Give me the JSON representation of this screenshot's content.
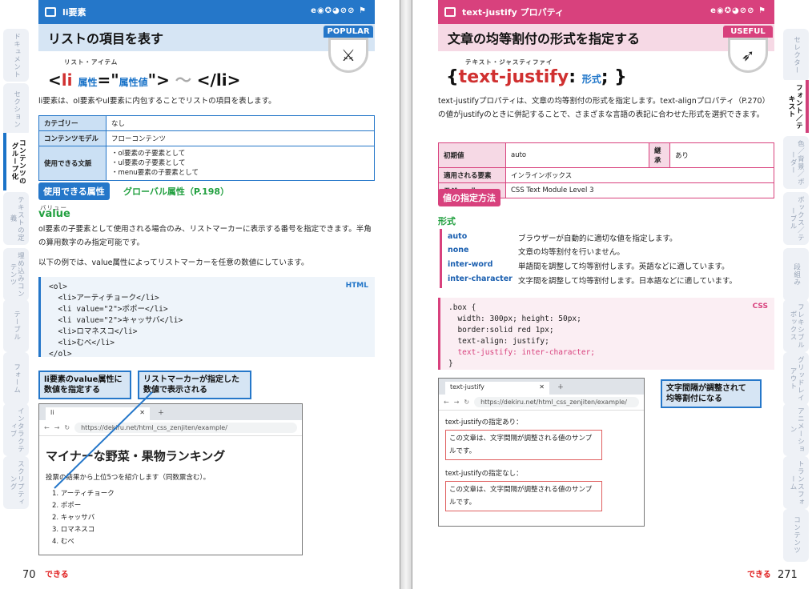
{
  "left": {
    "tabs": [
      "ドキュメント",
      "セクション",
      "コンテンツのグループ化",
      "テキストの定義",
      "埋め込みコンテンツ",
      "テーブル",
      "フォーム",
      "インタラクティブ",
      "スクリプティング"
    ],
    "header": {
      "label": "li要素",
      "browsers": "e◉✪◕⊘⊘ ⚑"
    },
    "title": "リストの項目を表す",
    "badge": "POPULAR",
    "syntax_ruby": "リスト・アイテム",
    "syntax": {
      "open_lt": "<",
      "tag": "li",
      "attr": "属性",
      "eq": "=\"",
      "val": "属性値",
      "close": "\">",
      "tilde": "〜",
      "end": "</li>"
    },
    "desc": "li要素は、ol要素やul要素に内包することでリストの項目を表します。",
    "table": [
      {
        "k": "カテゴリー",
        "v": "なし"
      },
      {
        "k": "コンテンツモデル",
        "v": "フローコンテンツ"
      },
      {
        "k": "使用できる文脈",
        "v": "・ol要素の子要素として\n・ul要素の子要素として\n・menu要素の子要素として"
      }
    ],
    "attr_section": "使用できる属性",
    "global_attr": "グローバル属性（P.198）",
    "value_ruby": "バリュー",
    "value_name": "value",
    "value_desc": "ol要素の子要素として使用される場合のみ、リストマーカーに表示する番号を指定できます。半角の算用数字のみ指定可能です。",
    "example_desc": "以下の例では、value属性によってリストマーカーを任意の数値にしています。",
    "code_lang": "HTML",
    "code_lines": [
      "<ol>",
      "  <li>アーティチョーク</li>",
      "  <li value=\"2\">ポポー</li>",
      "  <li value=\"2\">キャッサバ</li>",
      "  <li>ロマネスコ</li>",
      "  <li>むべ</li>",
      "</ol>"
    ],
    "callout1": "li要素のvalue属性に\n数値を指定する",
    "callout2": "リストマーカーが指定した\n数値で表示される",
    "browser": {
      "tab": "li",
      "url": "https://dekiru.net/html_css_zenjiten/example/",
      "h1": "マイナーな野菜・果物ランキング",
      "p": "投票の結果から上位5つを紹介します（同数票含む）。",
      "items": [
        "1. アーティチョーク",
        "2. ポポー",
        "2. キャッサバ",
        "3. ロマネスコ",
        "4. むべ"
      ]
    },
    "page_num": "70",
    "logo": "できる"
  },
  "right": {
    "tabs": [
      "セレクター",
      "フォント／テキスト",
      "色／背景／ボーダー",
      "ボックス／テーブル",
      "段組み",
      "フレキシブルボックス",
      "グリッドレイアウト",
      "アニメーション",
      "トランスフォーム",
      "コンテンツ"
    ],
    "header": {
      "label": "text-justify プロパティ",
      "browsers": "e◉✪◕⊘⊘ ⚑"
    },
    "title": "文章の均等割付の形式を指定する",
    "badge": "USEFUL",
    "syntax_ruby": "テキスト・ジャスティファイ",
    "syntax": {
      "open": "{",
      "prop": "text-justify",
      "colon": ":",
      "fmt": "形式",
      "end": "; }"
    },
    "desc": "text-justifyプロパティは、文章の均等割付の形式を指定します。text-alignプロパティ（P.270）の値がjustifyのときに併記することで、さまざまな言語の表記に合わせた形式を選択できます。",
    "table": [
      {
        "k": "初期値",
        "v": "auto",
        "k2": "継承",
        "v2": "あり"
      },
      {
        "k": "適用される要素",
        "v": "インラインボックス"
      },
      {
        "k": "モジュール",
        "v": "CSS Text Module Level 3"
      }
    ],
    "section": "値の指定方法",
    "format_label": "形式",
    "formats": [
      {
        "k": "auto",
        "v": "ブラウザーが自動的に適切な値を指定します。"
      },
      {
        "k": "none",
        "v": "文章の均等割付を行いません。"
      },
      {
        "k": "inter-word",
        "v": "単語間を調整して均等割付します。英語などに適しています。"
      },
      {
        "k": "inter-character",
        "v": "文字間を調整して均等割付します。日本語などに適しています。"
      }
    ],
    "code_lang": "CSS",
    "code_lines": [
      ".box {",
      "  width: 300px; height: 50px;",
      "  border:solid red 1px;",
      "  text-align: justify;",
      "  text-justify: inter-character;",
      "}"
    ],
    "callout": "文字間隔が調整されて\n均等割付になる",
    "browser": {
      "tab": "text-justify",
      "url": "https://dekiru.net/html_css_zenjiten/example/",
      "label1": "text-justifyの指定あり：",
      "box1": "この文章は、文字間隔が調整される値のサンプルです。",
      "label2": "text-justifyの指定なし：",
      "box2": "この文章は、文字間隔が調整される値のサンプルです。"
    },
    "page_num": "271",
    "logo": "できる"
  },
  "colors": {
    "blue": "#2577c9",
    "pink": "#d8417d",
    "green": "#22a040"
  }
}
